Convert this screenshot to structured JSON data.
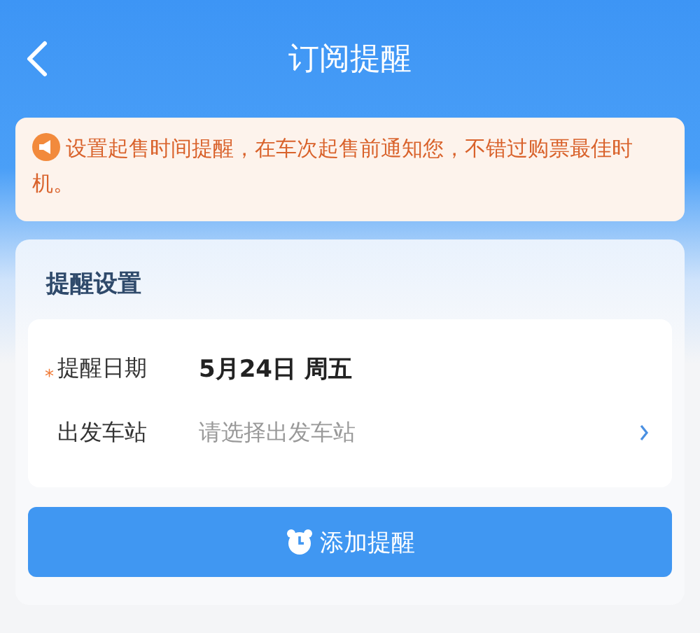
{
  "header": {
    "title": "订阅提醒"
  },
  "notice": {
    "text": "设置起售时间提醒，在车次起售前通知您，不错过购票最佳时机。"
  },
  "settings": {
    "title": "提醒设置",
    "rows": [
      {
        "kind": "value",
        "required_mark": "*",
        "label": "提醒日期",
        "value": "5月24日 周五"
      },
      {
        "kind": "picker",
        "label": "出发车站",
        "placeholder": "请选择出发车站"
      }
    ],
    "button": "添加提醒"
  }
}
